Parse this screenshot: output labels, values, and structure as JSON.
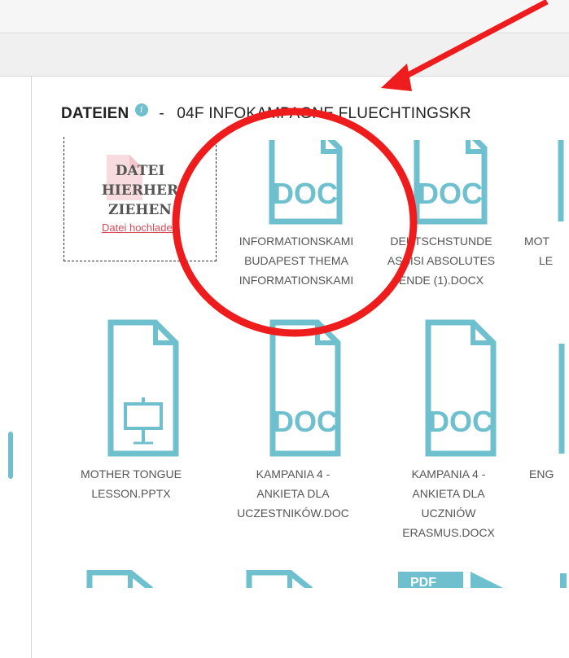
{
  "heading": {
    "title": "DATEIEN",
    "info_icon": "info-icon",
    "separator": "-",
    "folder": "04F INFOKAMPAGNE FLUECHTINGSKR"
  },
  "dropzone": {
    "lines": [
      "DATEI",
      "HIERHER",
      "ZIEHEN"
    ],
    "link": "Datei hochladen"
  },
  "files": [
    {
      "type": "DOC",
      "label_lines": [
        "INFORMATIONSKAMI",
        "BUDAPEST THEMA",
        "INFORMATIONSKAMI"
      ]
    },
    {
      "type": "DOC",
      "label_lines": [
        "DEUTSCHSTUNDE",
        "ASSISI ABSOLUTES",
        "ENDE (1).DOCX"
      ]
    },
    {
      "type": "DOC",
      "label_lines": [
        "MOT",
        "LE"
      ]
    },
    {
      "type": "PPTX",
      "label_lines": [
        "MOTHER TONGUE",
        "LESSON.PPTX"
      ]
    },
    {
      "type": "DOC",
      "label_lines": [
        "KAMPANIA 4 -",
        "ANKIETA DLA",
        "UCZESTNIKÓW.DOC"
      ]
    },
    {
      "type": "DOC",
      "label_lines": [
        "KAMPANIA 4 -",
        "ANKIETA DLA",
        "UCZNIÓW",
        "ERASMUS.DOCX"
      ]
    },
    {
      "type": "DOC",
      "label_lines": [
        "ENG"
      ]
    },
    {
      "type": "FILE",
      "label_lines": []
    },
    {
      "type": "FILE",
      "label_lines": []
    },
    {
      "type": "PDF",
      "label_lines": []
    },
    {
      "type": "FILE",
      "label_lines": []
    }
  ],
  "annotation": {
    "arrow_color": "#ee1c1c",
    "circle_color": "#ee1c1c"
  },
  "colors": {
    "accent": "#6fc0cf",
    "link": "#d94b5a"
  }
}
